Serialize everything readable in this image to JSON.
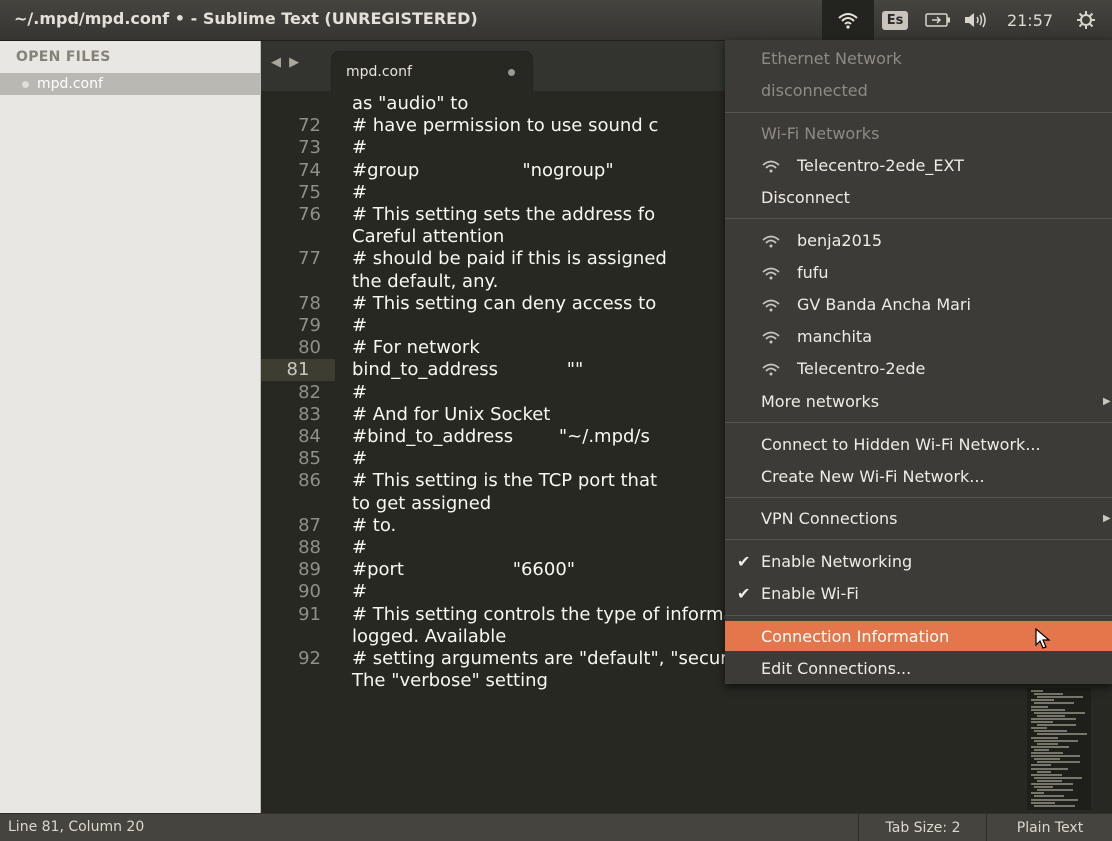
{
  "window": {
    "title": "~/.mpd/mpd.conf • - Sublime Text (UNREGISTERED)"
  },
  "panel": {
    "keyboard_layout": "Es",
    "clock": "21:57"
  },
  "sidebar": {
    "header": "OPEN FILES",
    "files": [
      "mpd.conf"
    ]
  },
  "tabs": {
    "nav": "◀ ▶",
    "active_tab": "mpd.conf"
  },
  "editor": {
    "lines": [
      {
        "num": "",
        "text": "as \"audio\" to"
      },
      {
        "num": "72",
        "text": "# have permission to use sound c"
      },
      {
        "num": "73",
        "text": "#"
      },
      {
        "num": "74",
        "text": "#group                  \"nogroup\""
      },
      {
        "num": "75",
        "text": "#"
      },
      {
        "num": "76",
        "text": "# This setting sets the address fo"
      },
      {
        "num": "",
        "text": "Careful attention"
      },
      {
        "num": "77",
        "text": "# should be paid if this is assigned"
      },
      {
        "num": "",
        "text": "the default, any."
      },
      {
        "num": "78",
        "text": "# This setting can deny access to"
      },
      {
        "num": "79",
        "text": "#"
      },
      {
        "num": "80",
        "text": "# For network"
      },
      {
        "num": "81",
        "text": "bind_to_address            \"\""
      },
      {
        "num": "82",
        "text": "#"
      },
      {
        "num": "83",
        "text": "# And for Unix Socket"
      },
      {
        "num": "84",
        "text": "#bind_to_address        \"~/.mpd/s"
      },
      {
        "num": "85",
        "text": "#"
      },
      {
        "num": "86",
        "text": "# This setting is the TCP port that"
      },
      {
        "num": "",
        "text": "to get assigned"
      },
      {
        "num": "87",
        "text": "# to."
      },
      {
        "num": "88",
        "text": "#"
      },
      {
        "num": "89",
        "text": "#port                   \"6600\""
      },
      {
        "num": "90",
        "text": "#"
      },
      {
        "num": "91",
        "text": "# This setting controls the type of information which is"
      },
      {
        "num": "",
        "text": "logged. Available"
      },
      {
        "num": "92",
        "text": "# setting arguments are \"default\", \"secure\" or \"verbose\"."
      },
      {
        "num": "",
        "text": "The \"verbose\" setting"
      }
    ],
    "active_line": "81"
  },
  "status": {
    "position": "Line 81, Column 20",
    "tab_size": "Tab Size: 2",
    "syntax": "Plain Text"
  },
  "network_menu": {
    "ethernet_header": "Ethernet Network",
    "ethernet_status": "disconnected",
    "wifi_header": "Wi-Fi Networks",
    "connected_network": "Telecentro-2ede_EXT",
    "disconnect": "Disconnect",
    "networks": [
      "benja2015",
      "fufu",
      "GV Banda Ancha Mari",
      "manchita",
      "Telecentro-2ede"
    ],
    "more_networks": "More networks",
    "hidden_network": "Connect to Hidden Wi-Fi Network...",
    "create_network": "Create New Wi-Fi Network...",
    "vpn": "VPN Connections",
    "enable_networking": "Enable Networking",
    "enable_wifi": "Enable Wi-Fi",
    "connection_info": "Connection Information",
    "edit_connections": "Edit Connections..."
  },
  "icons": {
    "wifi": "wifi-icon",
    "battery": "battery-icon",
    "volume": "volume-icon",
    "power": "power-gear-icon",
    "check": "checkmark-icon",
    "submenu": "submenu-arrow-icon",
    "pointer": "mouse-pointer-icon"
  }
}
